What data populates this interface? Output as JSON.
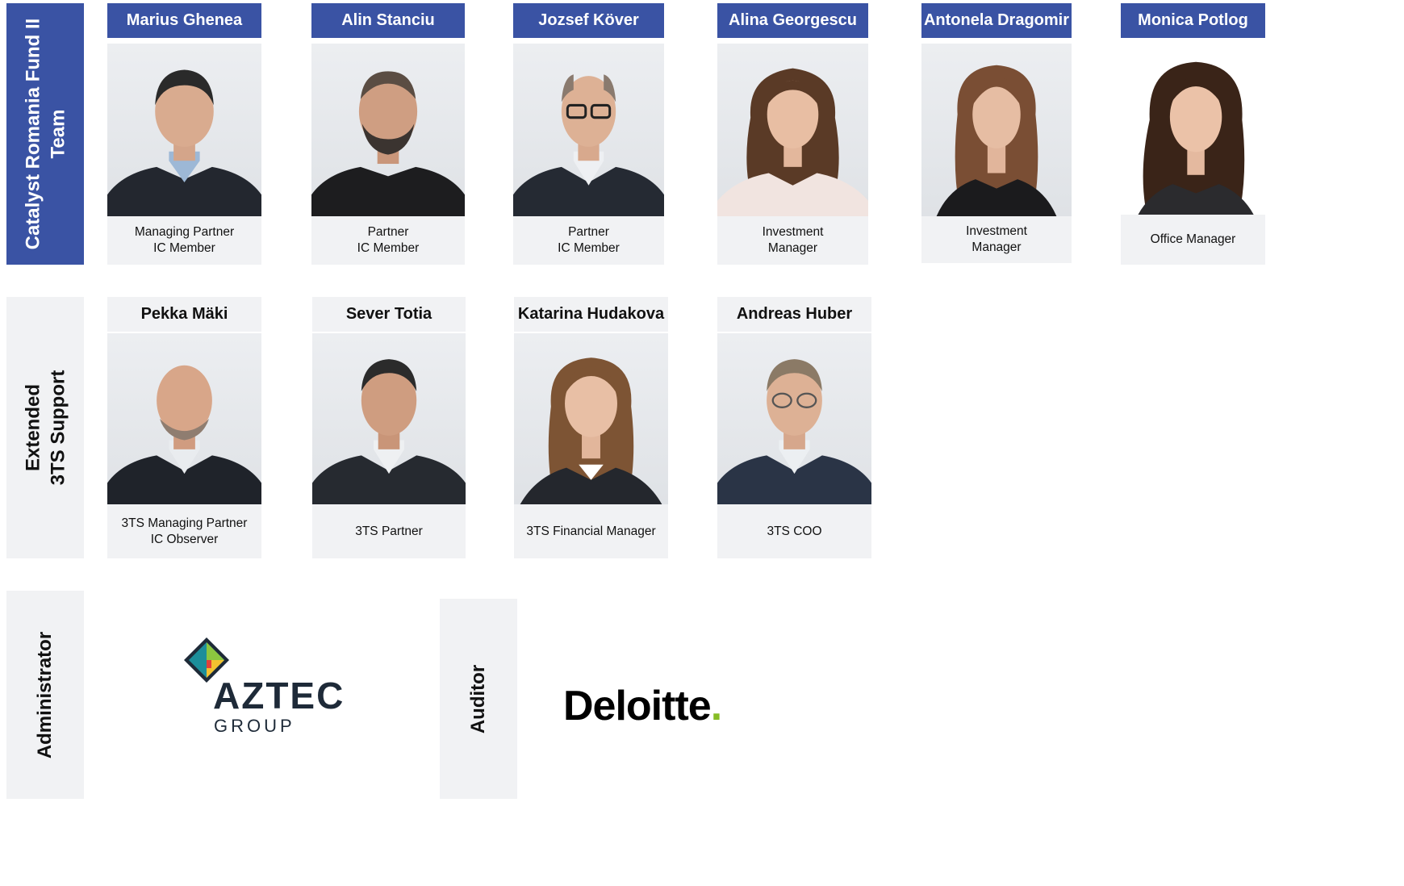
{
  "sections": {
    "core_team": [
      "Catalyst Romania Fund II",
      "Team"
    ],
    "extended_support": [
      "Extended",
      "3TS Support"
    ],
    "administrator": "Administrator",
    "auditor": "Auditor"
  },
  "core_team": [
    {
      "name": "Marius Ghenea",
      "role": [
        "Managing Partner",
        "IC Member"
      ]
    },
    {
      "name": "Alin Stanciu",
      "role": [
        "Partner",
        "IC Member"
      ]
    },
    {
      "name": "Jozsef Köver",
      "role": [
        "Partner",
        "IC Member"
      ]
    },
    {
      "name": "Alina Georgescu",
      "role": [
        "Investment",
        "Manager"
      ]
    },
    {
      "name": "Antonela Dragomir",
      "role": [
        "Investment",
        "Manager"
      ]
    },
    {
      "name": "Monica Potlog",
      "role": [
        "Office Manager"
      ]
    }
  ],
  "extended_team": [
    {
      "name": "Pekka Mäki",
      "role": [
        "3TS Managing Partner",
        "IC Observer"
      ]
    },
    {
      "name": "Sever Totia",
      "role": [
        "3TS Partner"
      ]
    },
    {
      "name": "Katarina Hudakova",
      "role": [
        "3TS Financial Manager"
      ]
    },
    {
      "name": "Andreas Huber",
      "role": [
        "3TS COO"
      ]
    }
  ],
  "administrator_logo": {
    "word": "AZTEC",
    "sub": "GROUP"
  },
  "auditor_logo": {
    "word": "Deloitte",
    "dot": "."
  },
  "colors": {
    "brand_blue": "#3a53a4",
    "panel_gray": "#f1f2f4",
    "deloitte_green": "#86bc25",
    "aztec_teal": "#1c8e9a",
    "aztec_green": "#8cc63f",
    "aztec_yellow": "#f2c230",
    "aztec_red": "#e3403a",
    "aztec_dark": "#1e2a38"
  }
}
